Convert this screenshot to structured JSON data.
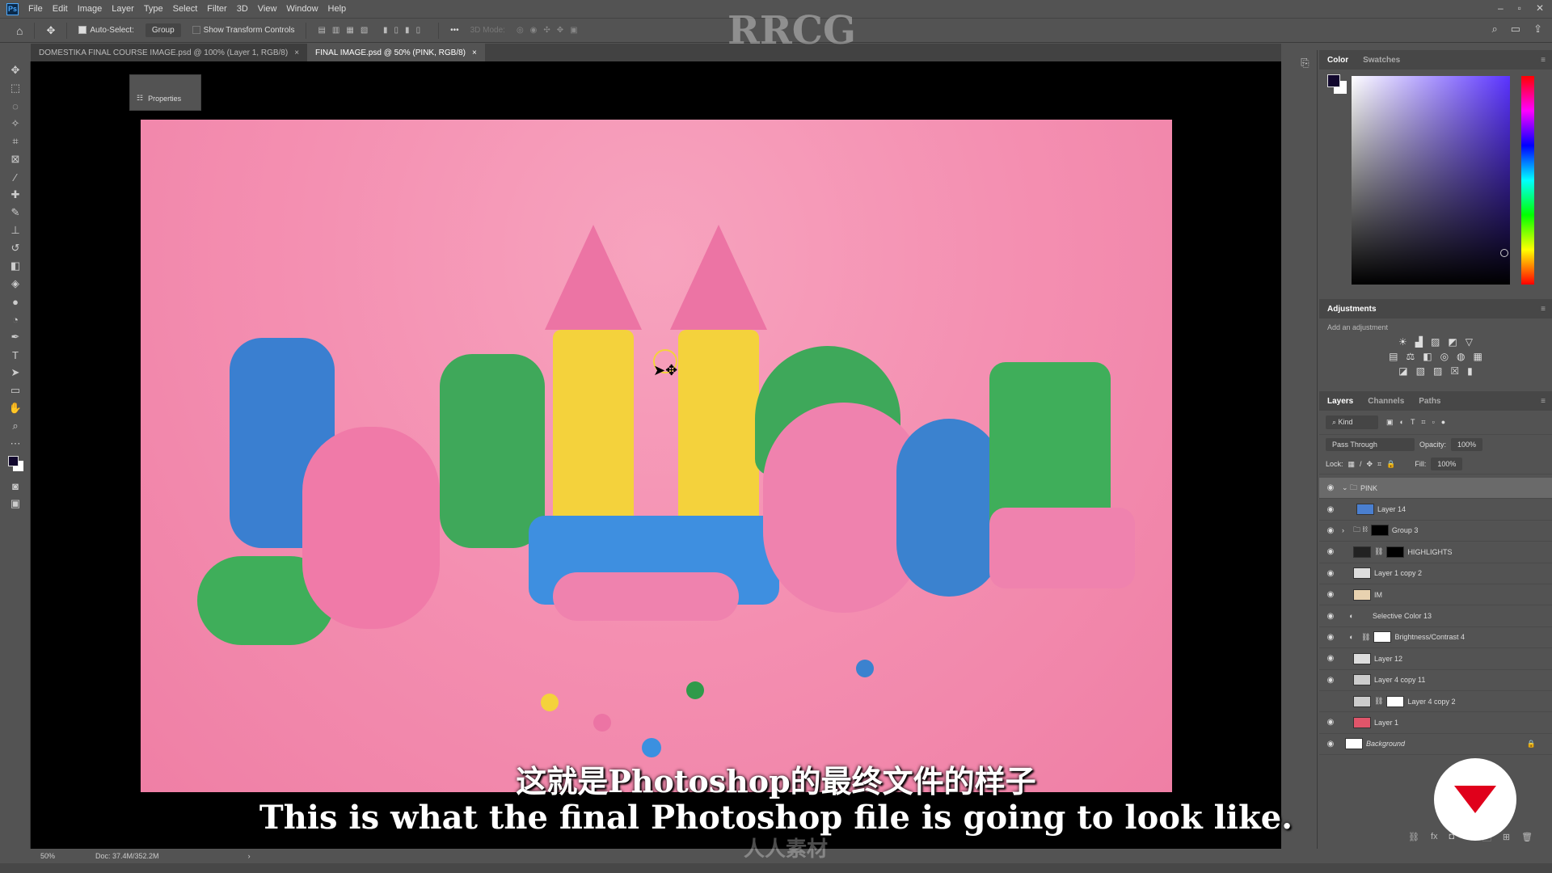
{
  "app": {
    "logo": "Ps",
    "menu": [
      "File",
      "Edit",
      "Image",
      "Layer",
      "Type",
      "Select",
      "Filter",
      "3D",
      "View",
      "Window",
      "Help"
    ]
  },
  "options": {
    "auto_select_label": "Auto-Select:",
    "auto_select_value": "Group",
    "show_transform": "Show Transform Controls",
    "more": "•••",
    "mode_3d": "3D Mode:"
  },
  "tabs": [
    {
      "label": "DOMESTIKA FINAL COURSE IMAGE.psd @ 100% (Layer 1, RGB/8)",
      "close": "×"
    },
    {
      "label": "FINAL IMAGE.psd @ 50% (PINK, RGB/8)",
      "close": "×"
    }
  ],
  "properties_panel": {
    "label": "Properties"
  },
  "watermark": "RRCG",
  "status": {
    "zoom": "50%",
    "doc": "Doc: 37.4M/352.2M",
    "arrow": "›"
  },
  "color_panel": {
    "tabs": [
      "Color",
      "Swatches"
    ],
    "foreground": "#12082e",
    "background": "#ffffff"
  },
  "adjustments": {
    "title": "Adjustments",
    "subtitle": "Add an adjustment"
  },
  "layers_panel": {
    "tabs": [
      "Layers",
      "Channels",
      "Paths"
    ],
    "filter": "Kind",
    "blend_mode": "Pass Through",
    "opacity_label": "Opacity:",
    "opacity": "100%",
    "lock_label": "Lock:",
    "fill_label": "Fill:",
    "fill": "100%",
    "layers": [
      {
        "name": "PINK",
        "visible": true,
        "selected": true
      },
      {
        "name": "Layer 14",
        "visible": true
      },
      {
        "name": "Group 3",
        "visible": true
      },
      {
        "name": "HIGHLIGHTS",
        "visible": true
      },
      {
        "name": "Layer 1 copy 2",
        "visible": true
      },
      {
        "name": "IM",
        "visible": true
      },
      {
        "name": "Selective Color 13",
        "visible": true
      },
      {
        "name": "Brightness/Contrast 4",
        "visible": true
      },
      {
        "name": "Layer 12",
        "visible": true
      },
      {
        "name": "Layer 4 copy 11",
        "visible": true
      },
      {
        "name": "Layer 4 copy 2",
        "visible": false
      },
      {
        "name": "Layer 1",
        "visible": true
      },
      {
        "name": "Background",
        "visible": true,
        "locked": true
      }
    ]
  },
  "subtitles": {
    "zh": "这就是Photoshop的最终文件的样子",
    "en": "This is what the final Photoshop file is going to look like."
  },
  "footer_watermark": "人人素材"
}
